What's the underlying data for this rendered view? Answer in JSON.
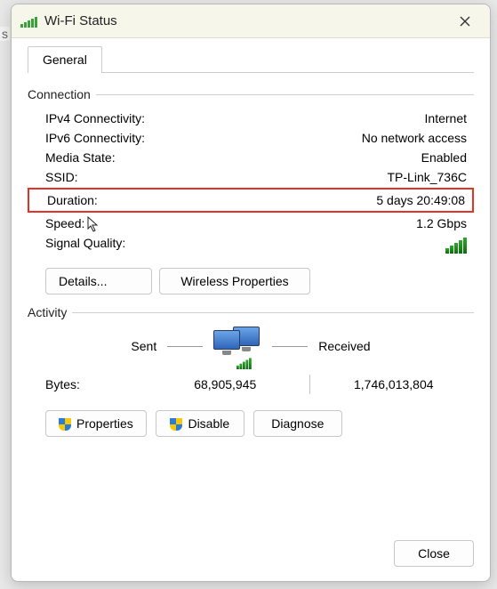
{
  "window": {
    "title": "Wi-Fi Status"
  },
  "tabs": {
    "general": "General"
  },
  "connection": {
    "section_label": "Connection",
    "ipv4_label": "IPv4 Connectivity:",
    "ipv4_value": "Internet",
    "ipv6_label": "IPv6 Connectivity:",
    "ipv6_value": "No network access",
    "media_state_label": "Media State:",
    "media_state_value": "Enabled",
    "ssid_label": "SSID:",
    "ssid_value": "TP-Link_736C",
    "duration_label": "Duration:",
    "duration_value": "5 days 20:49:08",
    "speed_label": "Speed:",
    "speed_value": "1.2 Gbps",
    "signal_quality_label": "Signal Quality:",
    "details_btn": "Details...",
    "wireless_props_btn": "Wireless Properties"
  },
  "activity": {
    "section_label": "Activity",
    "sent_label": "Sent",
    "received_label": "Received",
    "bytes_label": "Bytes:",
    "bytes_sent": "68,905,945",
    "bytes_received": "1,746,013,804"
  },
  "lower_buttons": {
    "properties": "Properties",
    "disable": "Disable",
    "diagnose": "Diagnose"
  },
  "footer": {
    "close": "Close"
  }
}
